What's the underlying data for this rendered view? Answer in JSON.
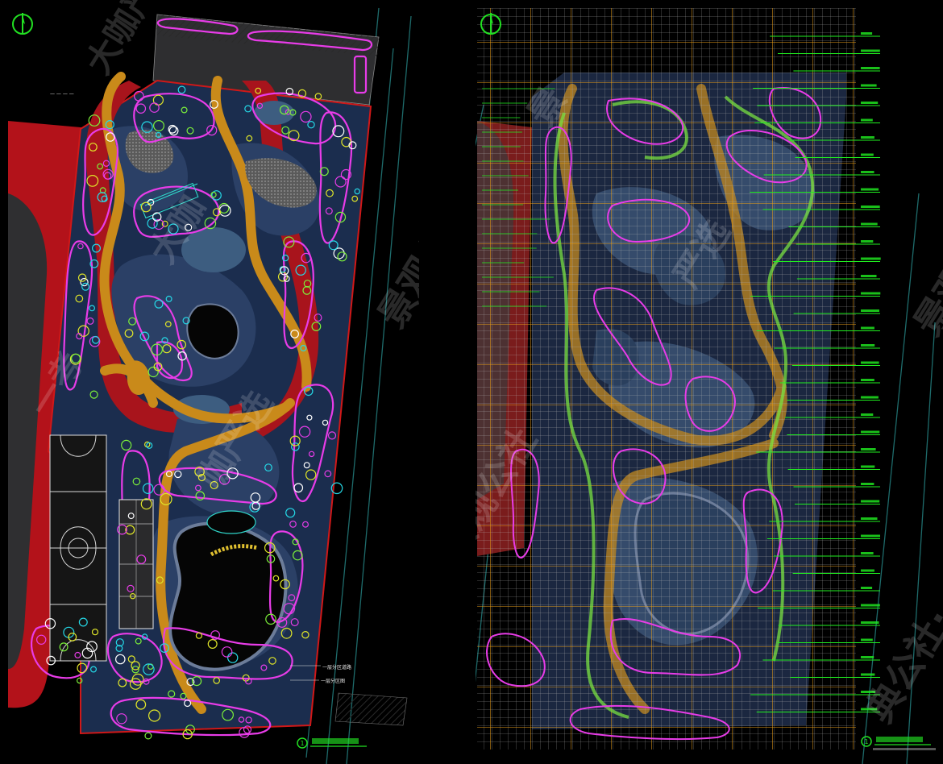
{
  "colors": {
    "background": "#000000",
    "asphalt": "#3a3a3c",
    "track_red": "#b3121a",
    "ground": "#1b2d4e",
    "ground_light": "#2b4066",
    "lawn_blue": "#3d5d80",
    "path_gold": "#c98a1a",
    "hedge_magenta": "#e83ce8",
    "tree_yellow": "#e0e629",
    "tree_cyan": "#25d8e6",
    "grid_orange": "#e79d18",
    "grid_white": "#c8c8c8",
    "leader_green": "#20f020",
    "frame_red": "#d01818",
    "water_dark": "#050505",
    "gravel_gray": "#6e6e6e",
    "watermark": "#ffffff"
  },
  "left_sheet": {
    "north_arrow": "north-arrow-icon",
    "watermarks": [
      "大咖严选",
      "景观公社",
      "一考",
      "大咖",
      "咖严选"
    ],
    "title_number": "1",
    "notes": [
      "一层分区道路",
      "一层分区图"
    ]
  },
  "right_sheet": {
    "north_arrow": "north-arrow-icon",
    "watermarks": [
      "景观公社",
      "景观公",
      "景",
      "严选",
      "典公社·"
    ],
    "title_number": "1"
  }
}
